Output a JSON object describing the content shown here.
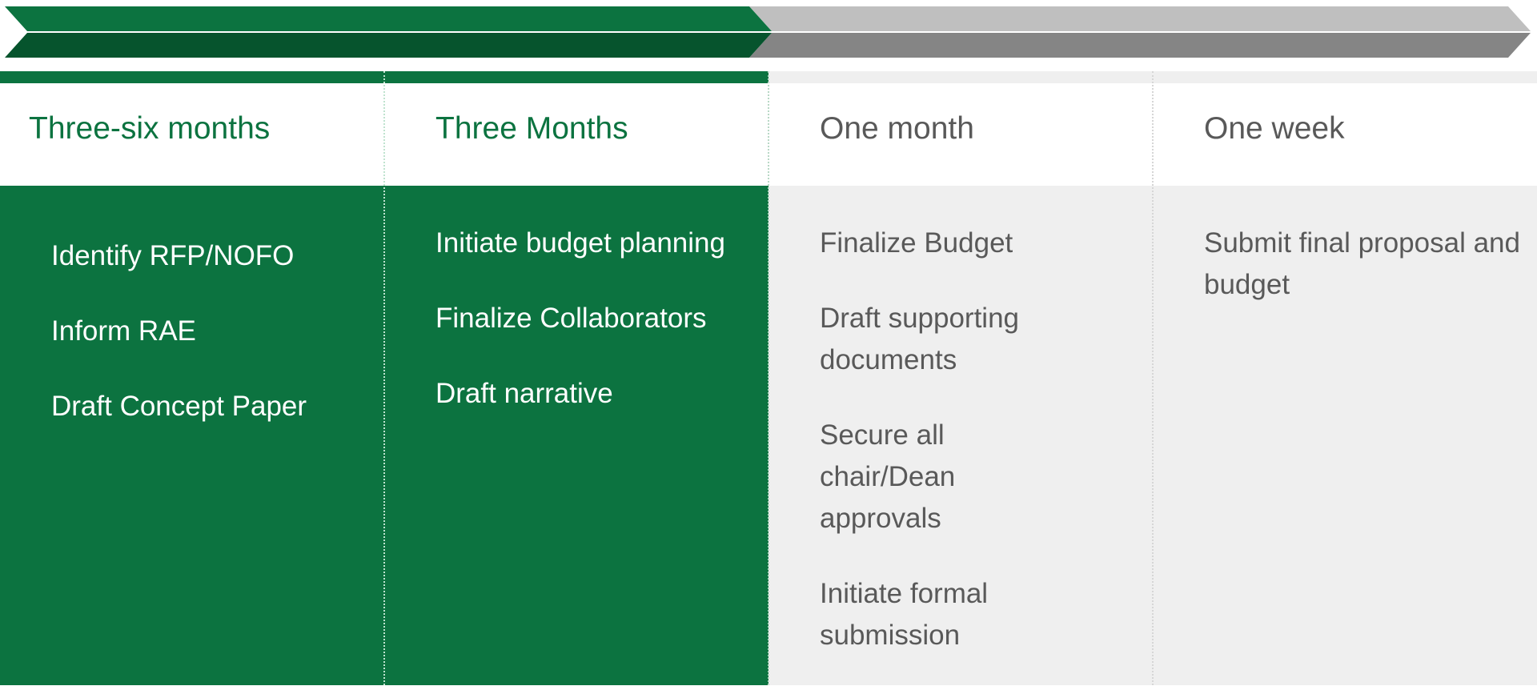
{
  "timeline": {
    "progress_fraction": 0.5,
    "colors": {
      "active": "#0c7340",
      "active_dark": "#06542d",
      "inactive_light": "#bfbfbf",
      "inactive_dark": "#858585",
      "panel_inactive": "#efefef",
      "text_inactive": "#595959",
      "text_active_body": "#ffffff"
    },
    "phases": [
      {
        "label": "Three-six months",
        "state": "active",
        "tasks": [
          "Identify RFP/NOFO",
          "Inform RAE",
          "Draft Concept Paper"
        ]
      },
      {
        "label": "Three Months",
        "state": "active",
        "tasks": [
          "Initiate budget planning",
          "Finalize Collaborators",
          "Draft narrative"
        ]
      },
      {
        "label": "One month",
        "state": "inactive",
        "tasks": [
          "Finalize Budget",
          "Draft supporting documents",
          "Secure all chair/Dean approvals",
          "Initiate formal submission"
        ]
      },
      {
        "label": "One week",
        "state": "inactive",
        "tasks": [
          "Submit final proposal and budget"
        ]
      }
    ]
  }
}
